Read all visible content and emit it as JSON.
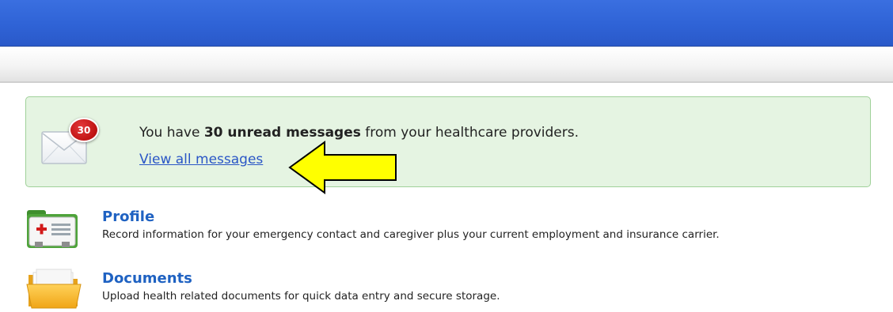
{
  "messages": {
    "unread_count": "30",
    "text_prefix": "You have ",
    "text_strong": "30 unread messages",
    "text_suffix": " from your healthcare providers.",
    "link_label": "View all messages",
    "icon": "envelope-icon"
  },
  "sections": [
    {
      "title": "Profile",
      "description": "Record information for your emergency contact and caregiver plus your current employment and insurance carrier.",
      "icon": "medical-folder-icon"
    },
    {
      "title": "Documents",
      "description": "Upload health related documents for quick data entry and secure storage.",
      "icon": "folder-icon"
    }
  ],
  "colors": {
    "header_blue": "#2f63d6",
    "panel_green": "#e5f4e2",
    "link_blue": "#2a56c6",
    "title_blue": "#1f62c2",
    "badge_red": "#c41515",
    "callout_yellow": "#ffff00"
  }
}
